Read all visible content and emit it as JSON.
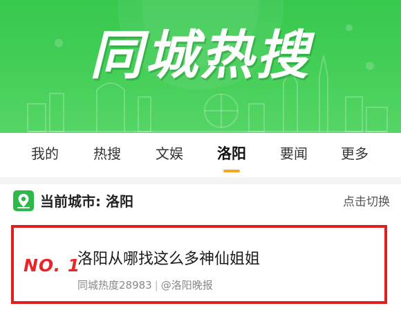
{
  "banner": {
    "title": "同城热搜"
  },
  "tabs": [
    {
      "label": "我的"
    },
    {
      "label": "热搜"
    },
    {
      "label": "文娱"
    },
    {
      "label": "洛阳",
      "active": true
    },
    {
      "label": "要闻"
    },
    {
      "label": "更多"
    }
  ],
  "city": {
    "prefix": "当前城市: ",
    "name": "洛阳",
    "switch_label": "点击切换",
    "icon": "location-pin-icon"
  },
  "hot_item": {
    "rank": "NO. 1",
    "title": "洛阳从哪找这么多神仙姐姐",
    "heat_label": "同城热度28983",
    "separator": "|",
    "source": "@洛阳晚报"
  },
  "colors": {
    "banner_green": "#45cf58",
    "accent_orange": "#f5a623",
    "highlight_red": "#e21d1d",
    "rank_red": "#e8262a",
    "icon_green": "#2db84a"
  }
}
